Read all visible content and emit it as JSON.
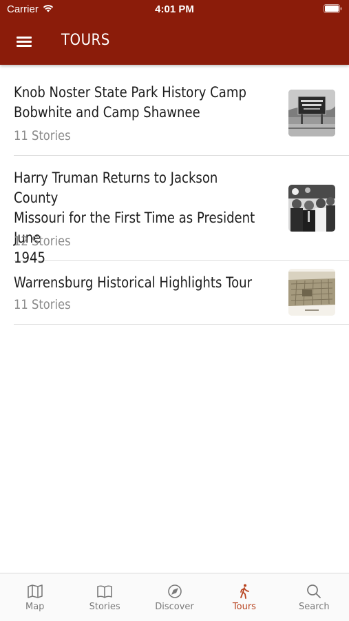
{
  "status_bar": {
    "carrier": "Carrier",
    "time": "4:01 PM"
  },
  "nav": {
    "title": "TOURS",
    "menu_icon": "hamburger-menu-icon"
  },
  "tours": [
    {
      "title": "Knob Noster State Park History Camp\nBobwhite and Camp Shawnee",
      "count": "11 Stories",
      "thumbnail": "park-sign-photo"
    },
    {
      "title": "Harry Truman Returns to Jackson County\nMissouri for the First Time as President June\n1945",
      "count": "12 Stories",
      "thumbnail": "truman-group-photo"
    },
    {
      "title": "Warrensburg Historical Highlights Tour",
      "count": "11 Stories",
      "thumbnail": "town-map-illustration"
    }
  ],
  "tabs": [
    {
      "label": "Map",
      "icon": "map-icon",
      "active": false
    },
    {
      "label": "Stories",
      "icon": "book-icon",
      "active": false
    },
    {
      "label": "Discover",
      "icon": "compass-icon",
      "active": false
    },
    {
      "label": "Tours",
      "icon": "walking-person-icon",
      "active": true
    },
    {
      "label": "Search",
      "icon": "search-icon",
      "active": false
    }
  ],
  "colors": {
    "header": "#8b1c0a",
    "active_tab": "#b8431f",
    "inactive_tab": "#7a7a7a",
    "secondary_text": "#8a8a8a"
  }
}
